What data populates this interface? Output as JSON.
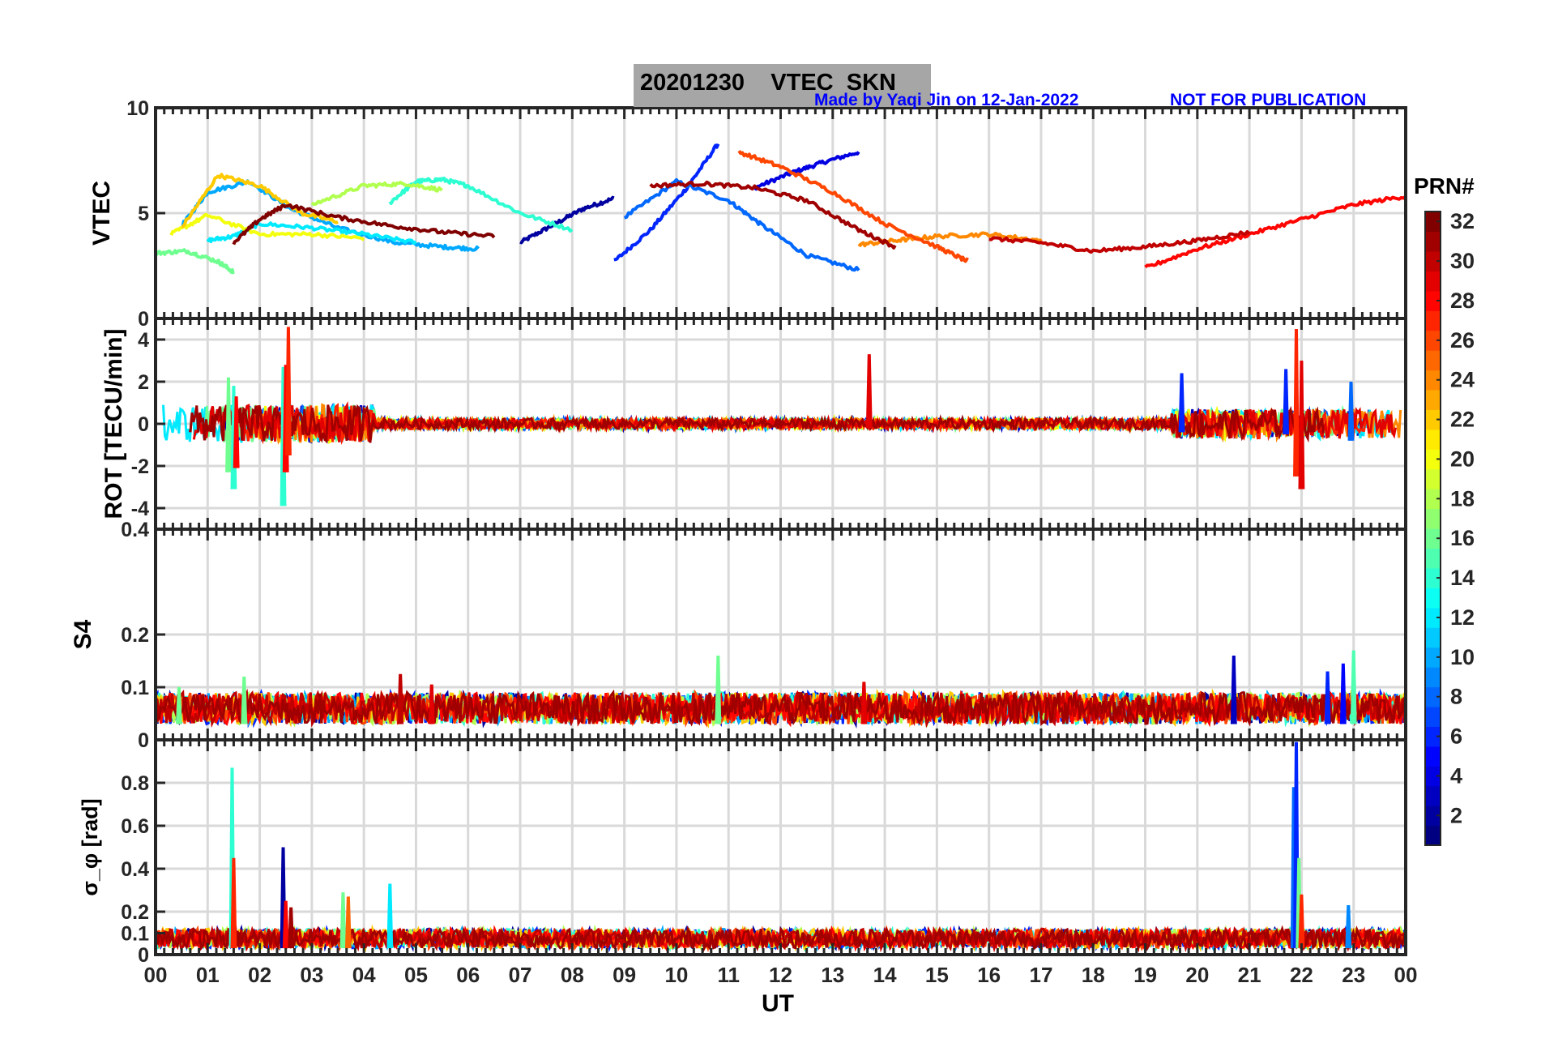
{
  "figure": {
    "date": "20201230",
    "title_rest": "VTEC  SKN",
    "credit": "Made by Yaqi Jin on 12-Jan-2022",
    "notice": "NOT FOR PUBLICATION",
    "xlabel": "UT"
  },
  "chart_data": [
    {
      "type": "line",
      "panel": "vtec",
      "ylabel": "VTEC",
      "ylim": [
        0,
        10
      ],
      "yticks": [
        "0",
        "5",
        "10"
      ],
      "xlim": [
        0,
        24
      ],
      "xticks": [
        "00",
        "01",
        "02",
        "03",
        "04",
        "05",
        "06",
        "07",
        "08",
        "09",
        "10",
        "11",
        "12",
        "13",
        "14",
        "15",
        "16",
        "17",
        "18",
        "19",
        "20",
        "21",
        "22",
        "23",
        "00"
      ],
      "grid": true,
      "series": [
        {
          "prn": 2,
          "x": [
            7.0,
            7.6,
            8.2,
            8.8
          ],
          "y": [
            3.6,
            4.4,
            5.2,
            5.7
          ]
        },
        {
          "prn": 4,
          "x": [
            11.5,
            12.2,
            12.8,
            13.5
          ],
          "y": [
            6.2,
            6.9,
            7.4,
            7.9
          ]
        },
        {
          "prn": 6,
          "x": [
            8.8,
            9.5,
            10.2,
            10.8
          ],
          "y": [
            2.7,
            4.2,
            6.2,
            8.3
          ]
        },
        {
          "prn": 8,
          "x": [
            9.0,
            10.0,
            11.0,
            11.6,
            12.5,
            13.5
          ],
          "y": [
            4.8,
            6.5,
            5.6,
            4.5,
            3.0,
            2.3
          ]
        },
        {
          "prn": 10,
          "x": [
            0.5,
            1.0,
            1.8,
            2.6,
            3.5,
            4.6,
            5.5,
            6.2
          ],
          "y": [
            4.4,
            6.0,
            6.5,
            5.2,
            4.3,
            3.6,
            3.4,
            3.3
          ]
        },
        {
          "prn": 12,
          "x": [
            1.0,
            1.5,
            2.0,
            3.0,
            4.0,
            5.0
          ],
          "y": [
            3.7,
            3.9,
            4.5,
            4.3,
            4.0,
            3.6
          ]
        },
        {
          "prn": 14,
          "x": [
            4.5,
            5.0,
            5.5,
            6.0,
            7.0,
            8.0
          ],
          "y": [
            5.5,
            6.5,
            6.6,
            6.3,
            5.0,
            4.2
          ]
        },
        {
          "prn": 16,
          "x": [
            0.0,
            0.6,
            1.2,
            1.5
          ],
          "y": [
            3.1,
            3.2,
            2.7,
            2.2
          ]
        },
        {
          "prn": 18,
          "x": [
            3.0,
            4.0,
            4.8,
            5.5
          ],
          "y": [
            5.4,
            6.3,
            6.4,
            6.1
          ]
        },
        {
          "prn": 20,
          "x": [
            0.3,
            1.0,
            2.0,
            3.0,
            4.0
          ],
          "y": [
            4.0,
            4.9,
            4.0,
            4.0,
            3.8
          ]
        },
        {
          "prn": 22,
          "x": [
            0.5,
            1.2,
            2.0,
            2.8,
            3.5
          ],
          "y": [
            4.3,
            6.8,
            6.3,
            5.0,
            4.6
          ]
        },
        {
          "prn": 24,
          "x": [
            13.5,
            14.2,
            15.0,
            16.0,
            17.0
          ],
          "y": [
            3.5,
            3.7,
            3.9,
            4.0,
            3.7
          ]
        },
        {
          "prn": 26,
          "x": [
            11.2,
            12.0,
            13.0,
            14.0,
            15.0,
            15.6
          ],
          "y": [
            7.9,
            7.2,
            6.0,
            4.5,
            3.4,
            2.7
          ]
        },
        {
          "prn": 28,
          "x": [
            19.0,
            20.0,
            21.0,
            22.0,
            23.0,
            24.0
          ],
          "y": [
            2.4,
            3.3,
            4.0,
            4.7,
            5.4,
            5.8
          ]
        },
        {
          "prn": 30,
          "x": [
            16.0,
            17.0,
            18.0,
            19.0,
            20.0,
            21.0
          ],
          "y": [
            3.8,
            3.6,
            3.2,
            3.4,
            3.7,
            4.1
          ]
        },
        {
          "prn": 31,
          "x": [
            9.5,
            10.5,
            11.5,
            12.5,
            13.5,
            14.2
          ],
          "y": [
            6.3,
            6.4,
            6.2,
            5.6,
            4.2,
            3.4
          ]
        },
        {
          "prn": 32,
          "x": [
            1.5,
            2.0,
            2.5,
            3.5,
            4.5,
            5.5,
            6.5
          ],
          "y": [
            3.6,
            4.7,
            5.4,
            4.8,
            4.4,
            4.1,
            3.9
          ]
        }
      ]
    },
    {
      "type": "line",
      "panel": "rot",
      "ylabel": "ROT [TECU/min]",
      "ylim": [
        -5,
        5
      ],
      "yticks": [
        "-4",
        "-2",
        "0",
        "2",
        "4"
      ],
      "xlim": [
        0,
        24
      ],
      "grid": true,
      "spikes": [
        {
          "x": 1.4,
          "ymin": -2.3,
          "ymax": 2.2,
          "prn": 16
        },
        {
          "x": 1.5,
          "ymin": -3.1,
          "ymax": 1.8,
          "prn": 14
        },
        {
          "x": 1.55,
          "ymin": -2.1,
          "ymax": 1.3,
          "prn": 28
        },
        {
          "x": 2.45,
          "ymin": -3.9,
          "ymax": 2.7,
          "prn": 14
        },
        {
          "x": 2.5,
          "ymin": -2.3,
          "ymax": 2.8,
          "prn": 28
        },
        {
          "x": 2.55,
          "ymin": -1.5,
          "ymax": 4.6,
          "prn": 27
        },
        {
          "x": 13.7,
          "ymin": -0.2,
          "ymax": 3.3,
          "prn": 29
        },
        {
          "x": 19.7,
          "ymin": -0.4,
          "ymax": 2.4,
          "prn": 6
        },
        {
          "x": 21.7,
          "ymin": -0.5,
          "ymax": 2.6,
          "prn": 6
        },
        {
          "x": 21.9,
          "ymin": -2.5,
          "ymax": 4.5,
          "prn": 27
        },
        {
          "x": 22.0,
          "ymin": -3.1,
          "ymax": 3.0,
          "prn": 29
        },
        {
          "x": 22.95,
          "ymin": -0.8,
          "ymax": 2.0,
          "prn": 8
        }
      ]
    },
    {
      "type": "line",
      "panel": "s4",
      "ylabel": "S4",
      "ylim": [
        0,
        0.4
      ],
      "yticks": [
        "0",
        "0.1",
        "0.2",
        "0.4"
      ],
      "xlim": [
        0,
        24
      ],
      "grid": true,
      "baseline": [
        0.03,
        0.09
      ],
      "spikes": [
        {
          "x": 0.45,
          "ymax": 0.1,
          "prn": 16
        },
        {
          "x": 1.7,
          "ymax": 0.12,
          "prn": 16
        },
        {
          "x": 4.7,
          "ymax": 0.125,
          "prn": 30
        },
        {
          "x": 5.3,
          "ymax": 0.105,
          "prn": 29
        },
        {
          "x": 10.8,
          "ymax": 0.16,
          "prn": 16
        },
        {
          "x": 13.6,
          "ymax": 0.11,
          "prn": 29
        },
        {
          "x": 20.7,
          "ymax": 0.16,
          "prn": 3
        },
        {
          "x": 22.5,
          "ymax": 0.13,
          "prn": 6
        },
        {
          "x": 22.8,
          "ymax": 0.145,
          "prn": 5
        },
        {
          "x": 23.0,
          "ymax": 0.17,
          "prn": 15
        }
      ]
    },
    {
      "type": "line",
      "panel": "sigma_phi",
      "ylabel": "σ_φ [rad]",
      "ylim": [
        0,
        1
      ],
      "yticks": [
        "0",
        "0.1",
        "0.2",
        "0.4",
        "0.6",
        "0.8"
      ],
      "xlim": [
        0,
        24
      ],
      "grid": true,
      "baseline": [
        0.03,
        0.12
      ],
      "spikes": [
        {
          "x": 1.47,
          "ymax": 0.87,
          "prn": 14
        },
        {
          "x": 1.5,
          "ymax": 0.45,
          "prn": 27
        },
        {
          "x": 2.45,
          "ymax": 0.5,
          "prn": 2
        },
        {
          "x": 2.5,
          "ymax": 0.25,
          "prn": 28
        },
        {
          "x": 2.6,
          "ymax": 0.22,
          "prn": 31
        },
        {
          "x": 3.6,
          "ymax": 0.29,
          "prn": 16
        },
        {
          "x": 3.7,
          "ymax": 0.27,
          "prn": 25
        },
        {
          "x": 4.5,
          "ymax": 0.33,
          "prn": 12
        },
        {
          "x": 21.85,
          "ymax": 0.78,
          "prn": 8
        },
        {
          "x": 21.9,
          "ymax": 0.99,
          "prn": 6
        },
        {
          "x": 21.95,
          "ymax": 0.45,
          "prn": 16
        },
        {
          "x": 22.0,
          "ymax": 0.28,
          "prn": 27
        },
        {
          "x": 22.9,
          "ymax": 0.23,
          "prn": 9
        }
      ]
    }
  ],
  "colorbar": {
    "title": "PRN#",
    "min": 1,
    "max": 32,
    "ticks": [
      "2",
      "4",
      "6",
      "8",
      "10",
      "12",
      "14",
      "16",
      "18",
      "20",
      "22",
      "24",
      "26",
      "28",
      "30",
      "32"
    ],
    "colormap": "jet"
  },
  "colors": {
    "title_box": "#a6a6a6",
    "credit": "#0000ff",
    "grid": "#d9d9d9"
  }
}
